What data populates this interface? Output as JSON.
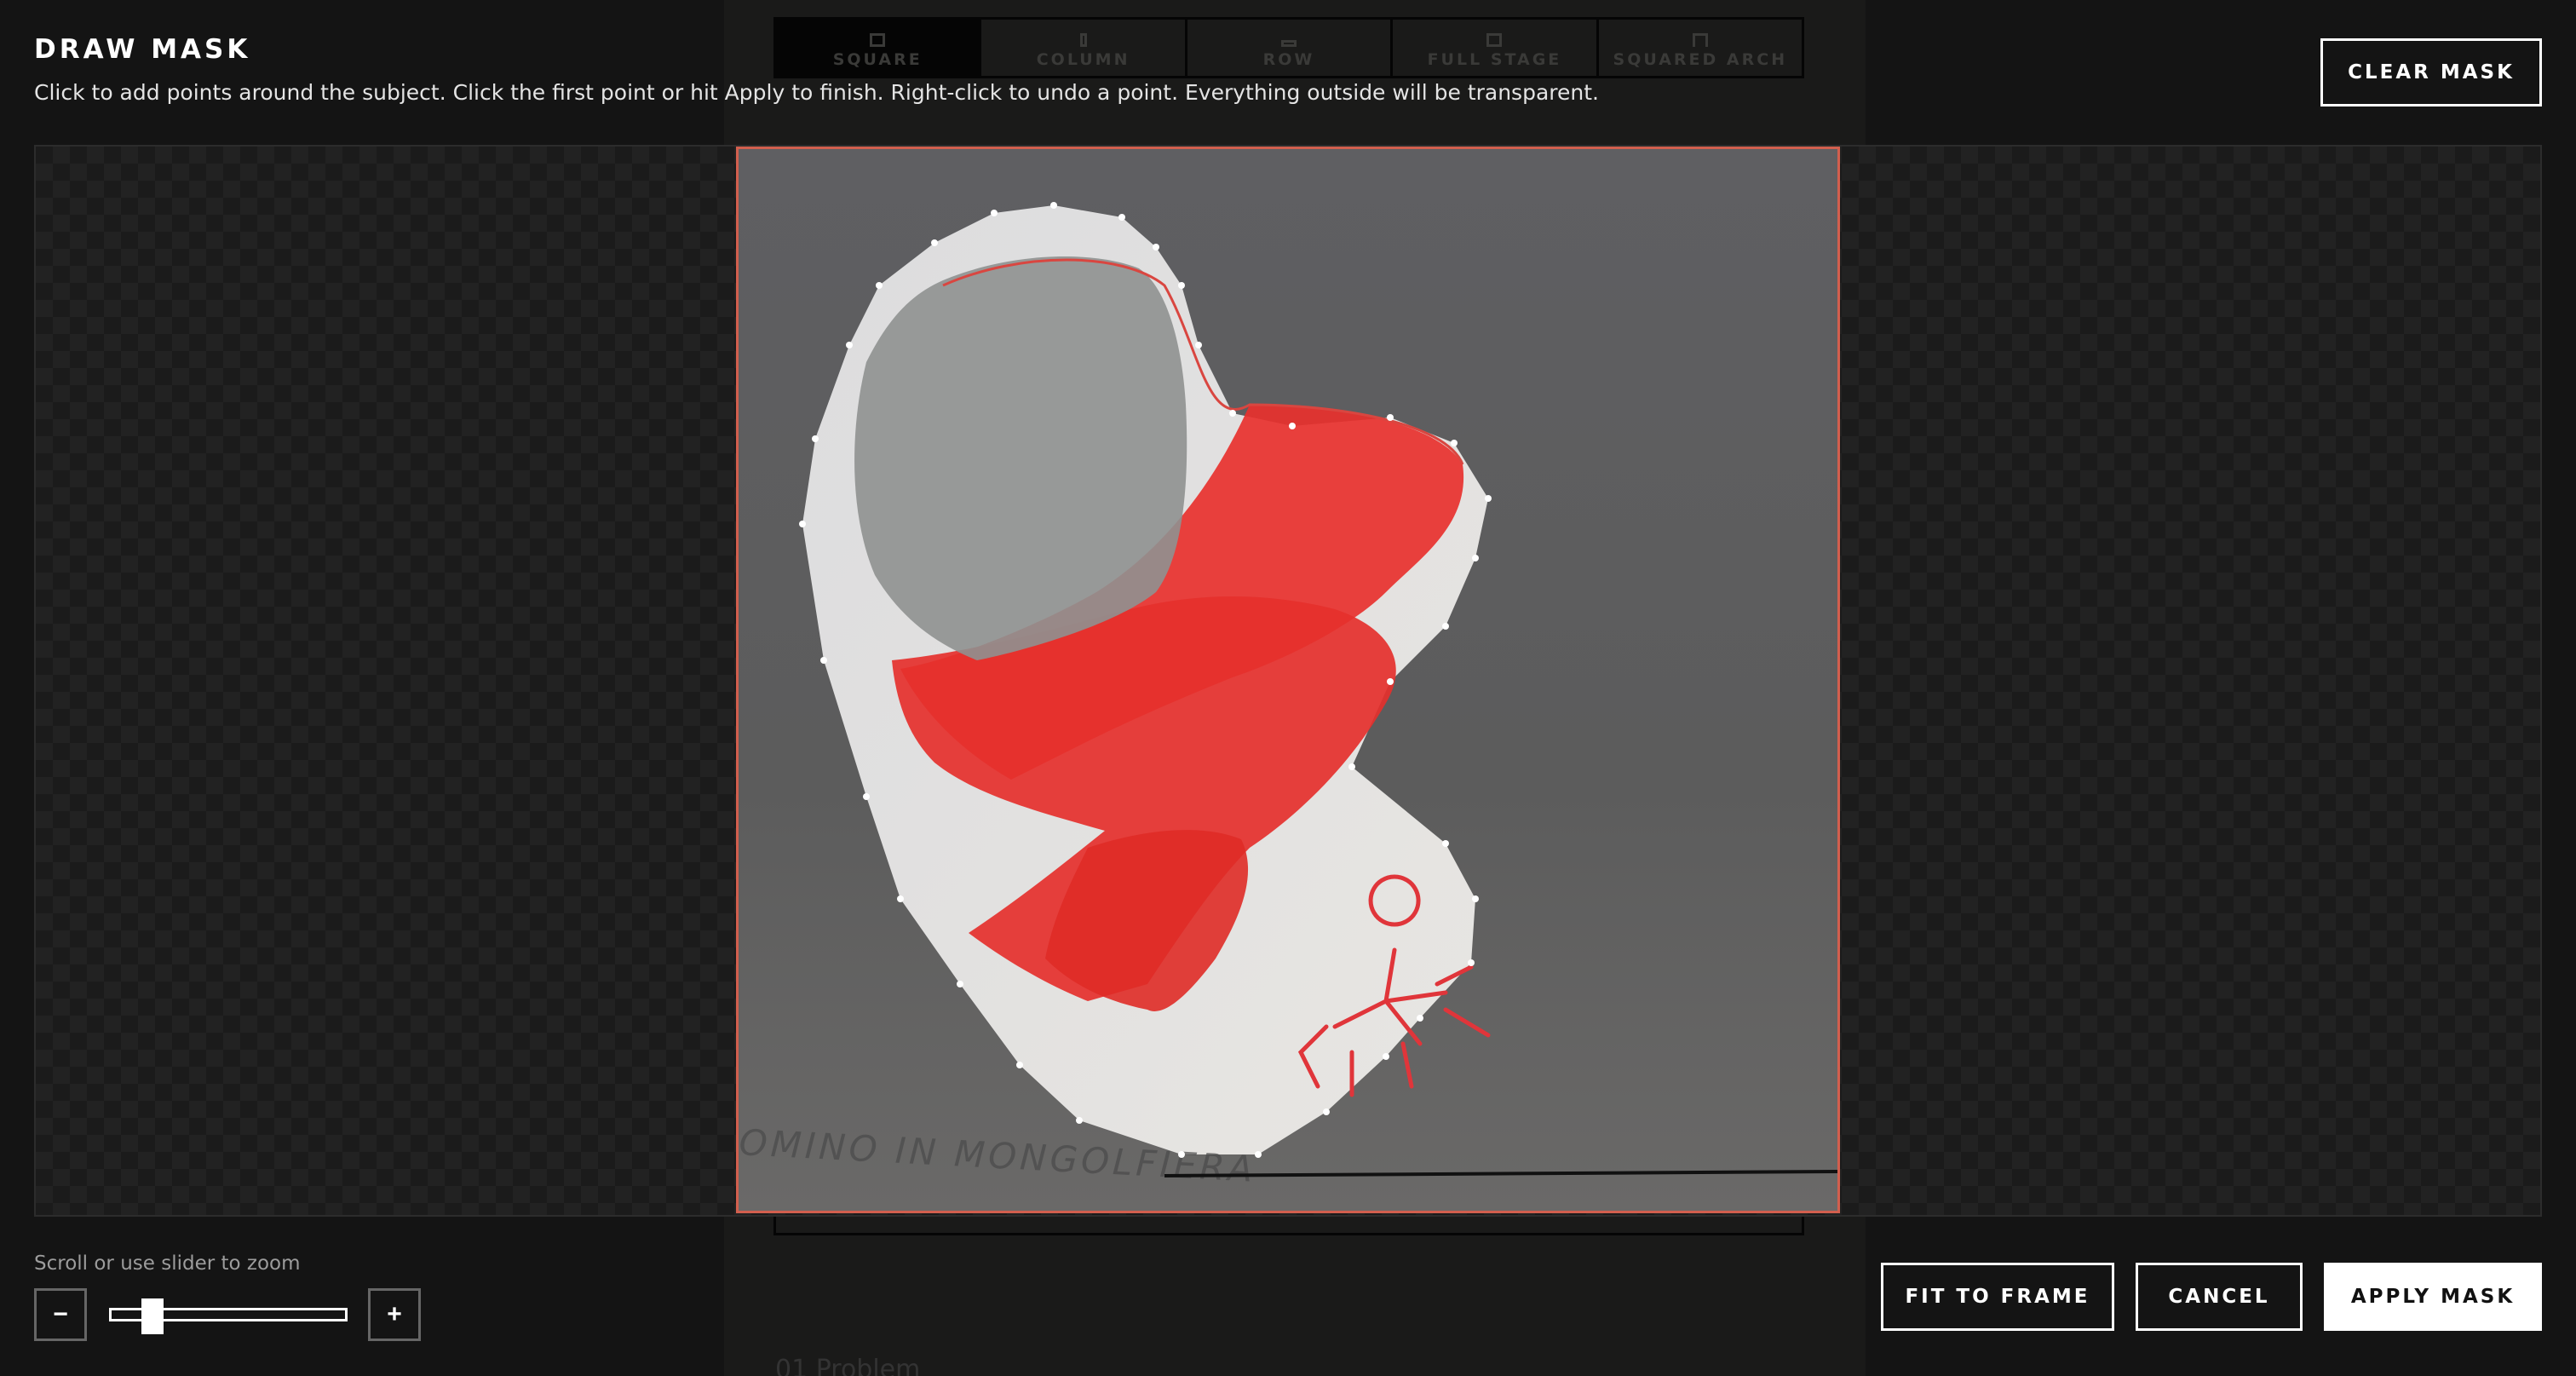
{
  "modal": {
    "title": "DRAW MASK",
    "instructions": "Click to add points around the subject. Click the first point or hit Apply to finish. Right-click to undo a point. Everything outside will be transparent."
  },
  "background_toolbar": {
    "items": [
      "SQUARE",
      "COLUMN",
      "ROW",
      "FULL STAGE",
      "SQUARED ARCH"
    ]
  },
  "background_row_text": "01 Problem",
  "image": {
    "caption_text": "OMINO IN MONGOLFIERA",
    "frame_color": "#d25f4e",
    "mask_point_color": "#ffffff",
    "drawing_colors": [
      "#e8312e",
      "#9a9a9a"
    ]
  },
  "actions": {
    "clear_mask": "CLEAR MASK",
    "fit_to_frame": "FIT TO FRAME",
    "cancel": "CANCEL",
    "apply_mask": "APPLY MASK"
  },
  "zoom": {
    "label": "Scroll or use slider to zoom",
    "minus": "−",
    "plus": "+",
    "level": 0.14
  }
}
